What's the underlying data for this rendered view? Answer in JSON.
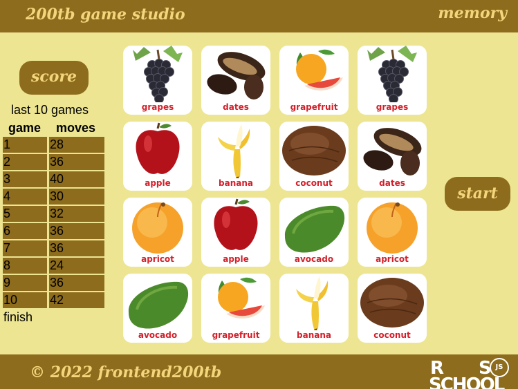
{
  "header": {
    "brand": "200tb game studio",
    "game_title": "memory"
  },
  "footer": {
    "copyright": "© 2022 frontend200tb"
  },
  "logo": {
    "line1_left": "R",
    "line1_right": "S",
    "line2": "SCHOOL",
    "badge": "JS"
  },
  "score": {
    "button_label": "score",
    "caption": "last 10 games",
    "headers": [
      "game",
      "moves"
    ],
    "rows": [
      {
        "game": "1",
        "moves": "28"
      },
      {
        "game": "2",
        "moves": "36"
      },
      {
        "game": "3",
        "moves": "40"
      },
      {
        "game": "4",
        "moves": "30"
      },
      {
        "game": "5",
        "moves": "32"
      },
      {
        "game": "6",
        "moves": "36"
      },
      {
        "game": "7",
        "moves": "36"
      },
      {
        "game": "8",
        "moves": "24"
      },
      {
        "game": "9",
        "moves": "36"
      },
      {
        "game": "10",
        "moves": "42"
      }
    ],
    "status": "finish"
  },
  "start": {
    "label": "start"
  },
  "board": {
    "cards": [
      {
        "fruit": "grapes",
        "label": "grapes"
      },
      {
        "fruit": "dates",
        "label": "dates"
      },
      {
        "fruit": "grapefruit",
        "label": "grapefruit"
      },
      {
        "fruit": "grapes",
        "label": "grapes"
      },
      {
        "fruit": "apple",
        "label": "apple"
      },
      {
        "fruit": "banana",
        "label": "banana"
      },
      {
        "fruit": "coconut",
        "label": "coconut"
      },
      {
        "fruit": "dates",
        "label": "dates"
      },
      {
        "fruit": "apricot",
        "label": "apricot"
      },
      {
        "fruit": "apple",
        "label": "apple"
      },
      {
        "fruit": "avocado",
        "label": "avocado"
      },
      {
        "fruit": "apricot",
        "label": "apricot"
      },
      {
        "fruit": "avocado",
        "label": "avocado"
      },
      {
        "fruit": "grapefruit",
        "label": "grapefruit"
      },
      {
        "fruit": "banana",
        "label": "banana"
      },
      {
        "fruit": "coconut",
        "label": "coconut"
      }
    ]
  },
  "colors": {
    "background": "#ede592",
    "bar": "#8d6c1d",
    "bar_text": "#f3d67c",
    "card_label": "#d3202a"
  }
}
